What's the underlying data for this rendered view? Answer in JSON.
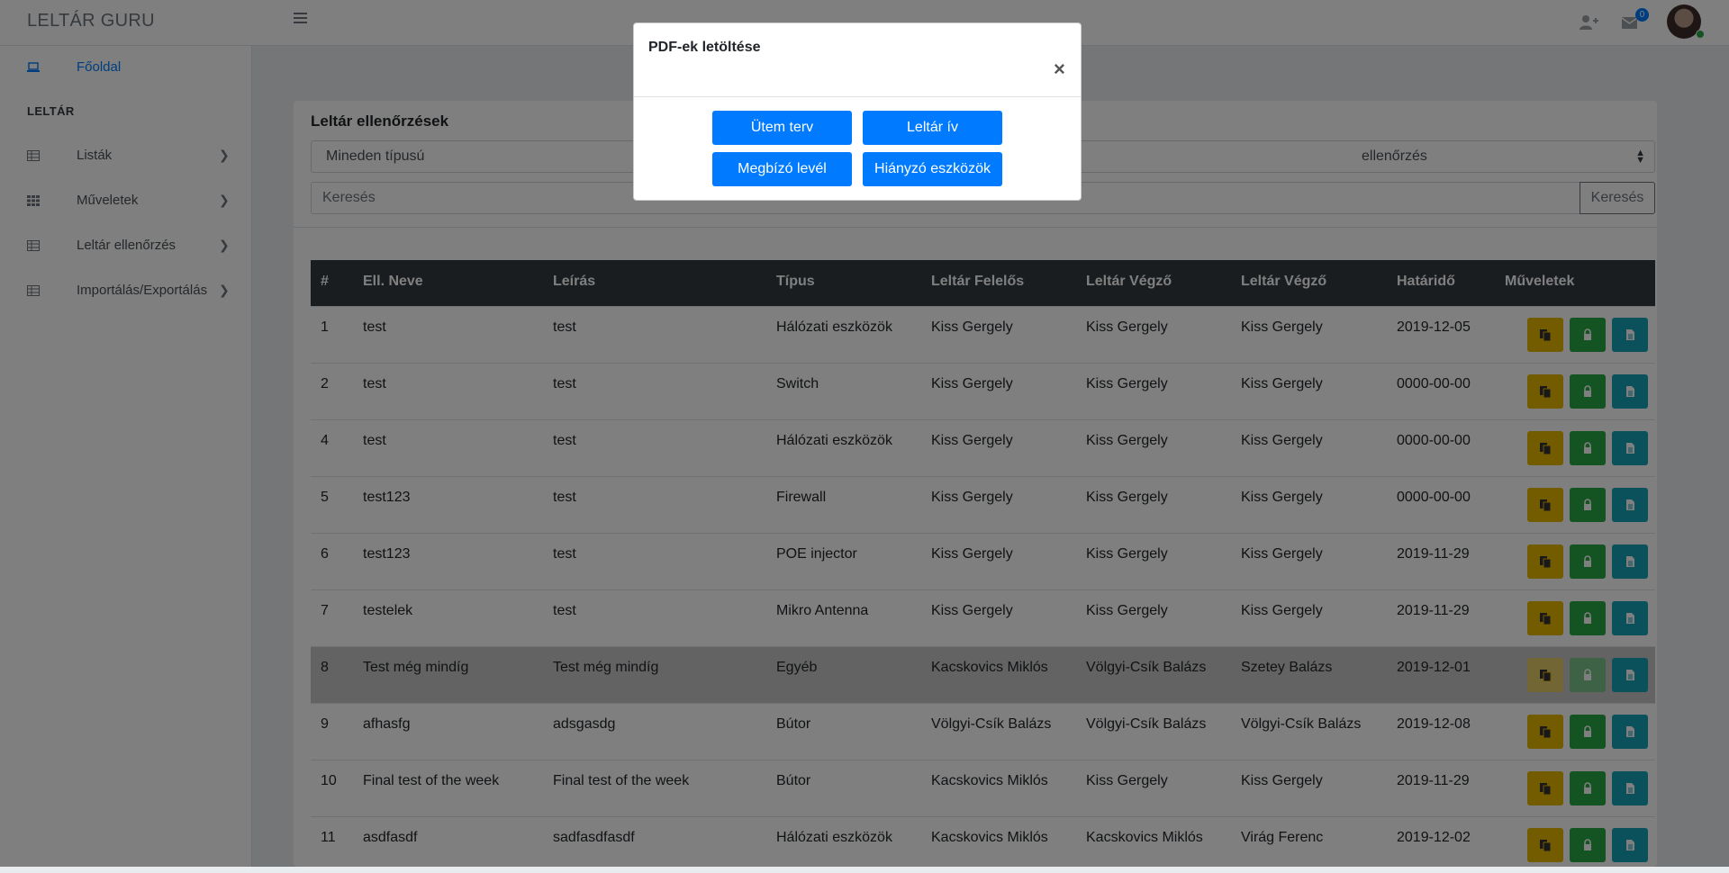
{
  "app": {
    "brand": "LELTÁR GURU"
  },
  "topbar": {
    "mail_badge": "0"
  },
  "sidebar": {
    "home": "Főoldal",
    "section_title": "LELTÁR",
    "items": [
      {
        "label": "Listák",
        "icon": "table-icon"
      },
      {
        "label": "Műveletek",
        "icon": "grid-icon"
      },
      {
        "label": "Leltár ellenőrzés",
        "icon": "table-icon"
      },
      {
        "label": "Importálás/Exportálás",
        "icon": "table-icon"
      }
    ]
  },
  "main": {
    "title": "Leltár ellenőrzések",
    "type_select": "Mineden típusú",
    "check_select": "ellenőrzés",
    "search_placeholder": "Keresés",
    "search_button": "Keresés"
  },
  "table": {
    "headers": [
      "#",
      "Ell. Neve",
      "Leírás",
      "Típus",
      "Leltár Felelős",
      "Leltár Végző",
      "Leltár Végző",
      "Határidő",
      "Műveletek"
    ],
    "rows": [
      [
        "1",
        "test",
        "test",
        "Hálózati eszközök",
        "Kiss Gergely",
        "Kiss Gergely",
        "Kiss Gergely",
        "2019-12-05"
      ],
      [
        "2",
        "test",
        "test",
        "Switch",
        "Kiss Gergely",
        "Kiss Gergely",
        "Kiss Gergely",
        "0000-00-00"
      ],
      [
        "4",
        "test",
        "test",
        "Hálózati eszközök",
        "Kiss Gergely",
        "Kiss Gergely",
        "Kiss Gergely",
        "0000-00-00"
      ],
      [
        "5",
        "test123",
        "test",
        "Firewall",
        "Kiss Gergely",
        "Kiss Gergely",
        "Kiss Gergely",
        "0000-00-00"
      ],
      [
        "6",
        "test123",
        "test",
        "POE injector",
        "Kiss Gergely",
        "Kiss Gergely",
        "Kiss Gergely",
        "2019-11-29"
      ],
      [
        "7",
        "testelek",
        "test",
        "Mikro Antenna",
        "Kiss Gergely",
        "Kiss Gergely",
        "Kiss Gergely",
        "2019-11-29"
      ],
      [
        "8",
        "Test még mindíg",
        "Test még mindíg",
        "Egyéb",
        "Kacskovics Miklós",
        "Völgyi-Csík Balázs",
        "Szetey Balázs",
        "2019-12-01"
      ],
      [
        "9",
        "afhasfg",
        "adsgasdg",
        "Bútor",
        "Völgyi-Csík Balázs",
        "Völgyi-Csík Balázs",
        "Völgyi-Csík Balázs",
        "2019-12-08"
      ],
      [
        "10",
        "Final test of the week",
        "Final test of the week",
        "Bútor",
        "Kacskovics Miklós",
        "Kiss Gergely",
        "Kiss Gergely",
        "2019-11-29"
      ],
      [
        "11",
        "asdfasdf",
        "sadfasdfasdf",
        "Hálózati eszközök",
        "Kacskovics Miklós",
        "Kacskovics Miklós",
        "Virág Ferenc",
        "2019-12-02"
      ]
    ],
    "highlighted_row": 6
  },
  "modal": {
    "title": "PDF-ek letöltése",
    "close": "×",
    "buttons": [
      "Ütem terv",
      "Leltár ív",
      "Megbízó levél",
      "Hiányzó eszközök"
    ]
  },
  "colors": {
    "primary": "#007bff",
    "warning": "#e6b700",
    "success": "#28a745",
    "info": "#17a2b8",
    "table_head": "#343a40"
  }
}
